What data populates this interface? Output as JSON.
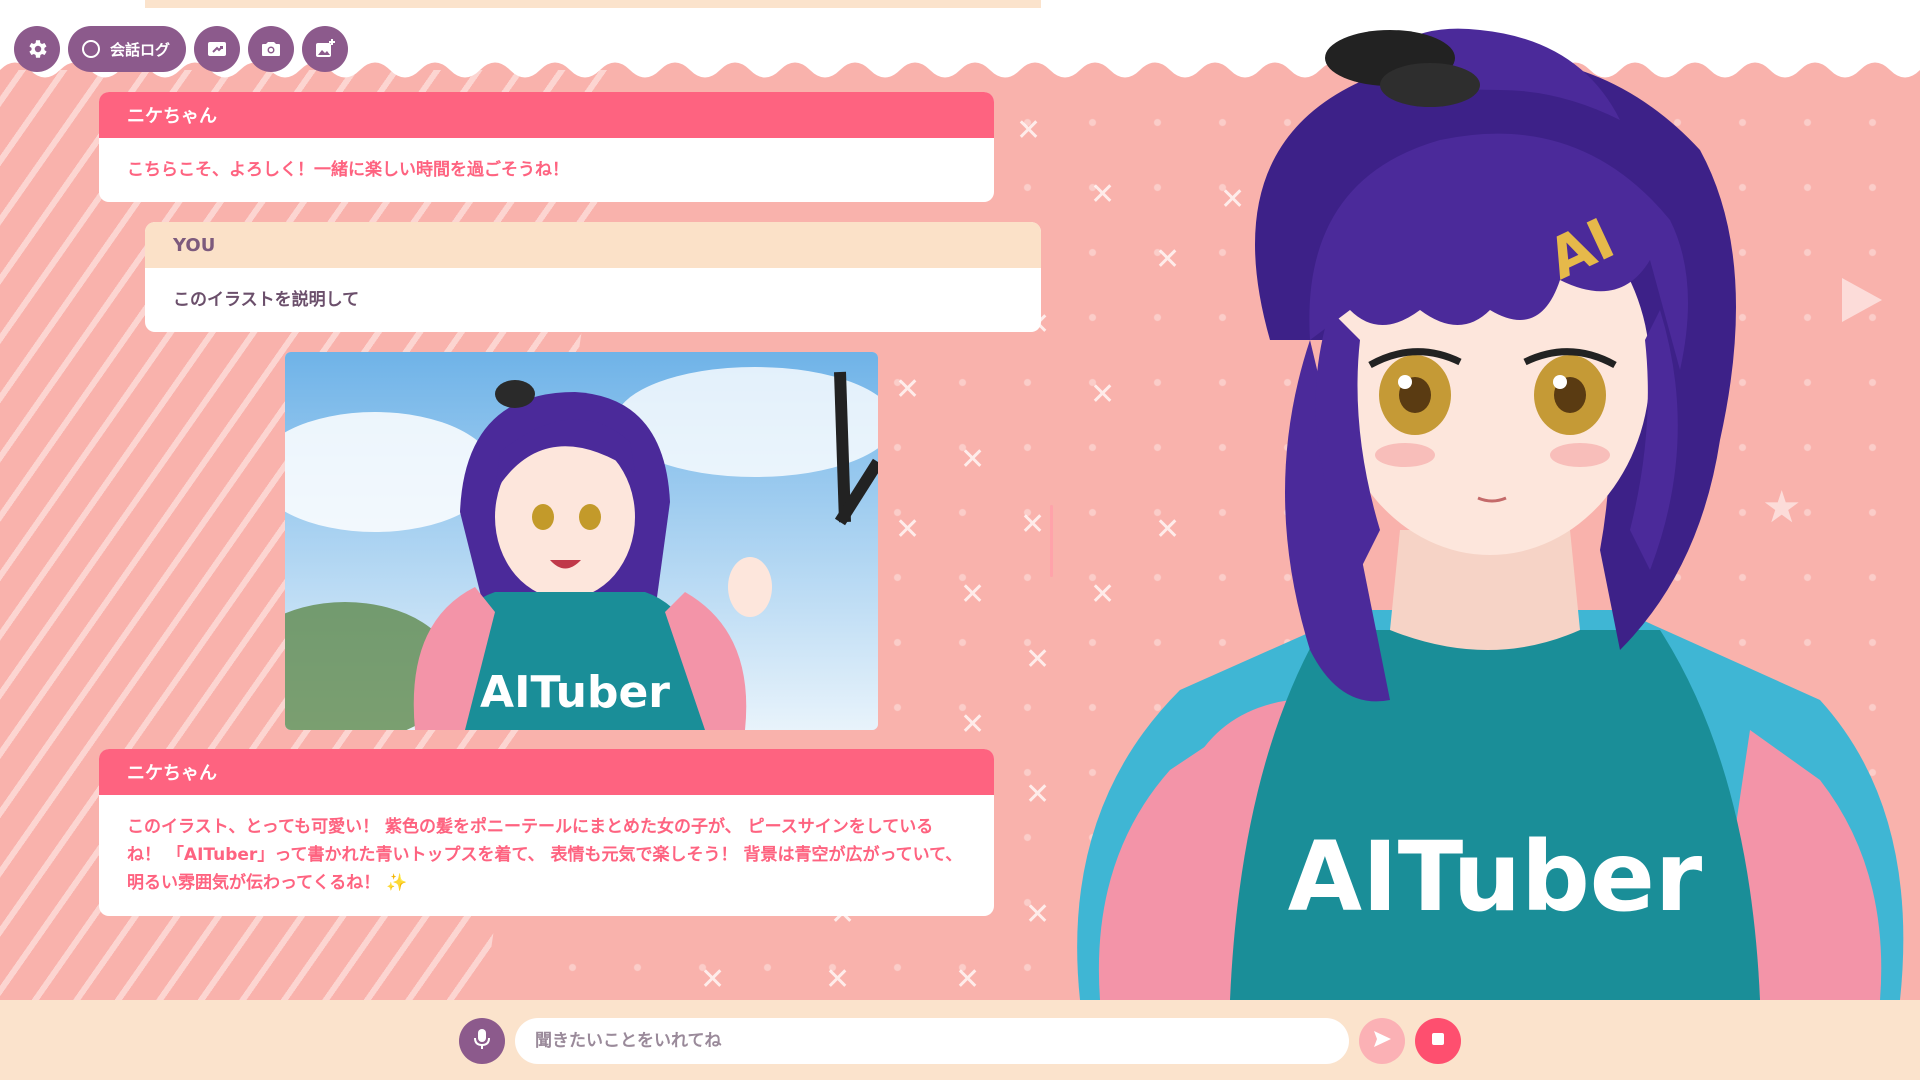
{
  "toolbar": {
    "settings_icon": "gear-icon",
    "chat_log_label": "会話ログ",
    "chat_log_icon": "circle-outline-icon",
    "share_screen_icon": "screen-share-icon",
    "camera_icon": "camera-icon",
    "add_image_icon": "image-add-icon"
  },
  "chat": {
    "messages": [
      {
        "role": "assistant",
        "speaker": "ニケちゃん",
        "text": "こちらこそ、よろしく！一緒に楽しい時間を過ごそうね！"
      },
      {
        "role": "user",
        "speaker": "YOU",
        "text": "このイラストを説明して"
      },
      {
        "role": "assistant",
        "speaker": "ニケちゃん",
        "text": "このイラスト、とっても可愛い！ 紫色の髪をポニーテールにまとめた女の子が、 ピースサインをしているね！ 「AITuber」って書かれた青いトップスを着て、 表情も元気で楽しそう！ 背景は青空が広がっていて、明るい雰囲気が伝わってくるね！ ✨"
      }
    ],
    "shared_image_shirt_text": "AITuber"
  },
  "character": {
    "shirt_text": "AITuber",
    "hairclip_text": "AI"
  },
  "input": {
    "placeholder": "聞きたいことをいれてね",
    "value": "",
    "mic_icon": "microphone-icon",
    "send_icon": "send-arrow-icon",
    "stop_icon": "stop-square-icon"
  },
  "colors": {
    "background": "#f9b2ac",
    "accent_pink": "#fe6380",
    "toolbar_purple": "#8c5a8c",
    "user_header": "#fbe1c8",
    "bottom_bar": "#fbe3cc",
    "shirt_teal": "#1a8e98",
    "hair_purple": "#4b2a9a"
  }
}
